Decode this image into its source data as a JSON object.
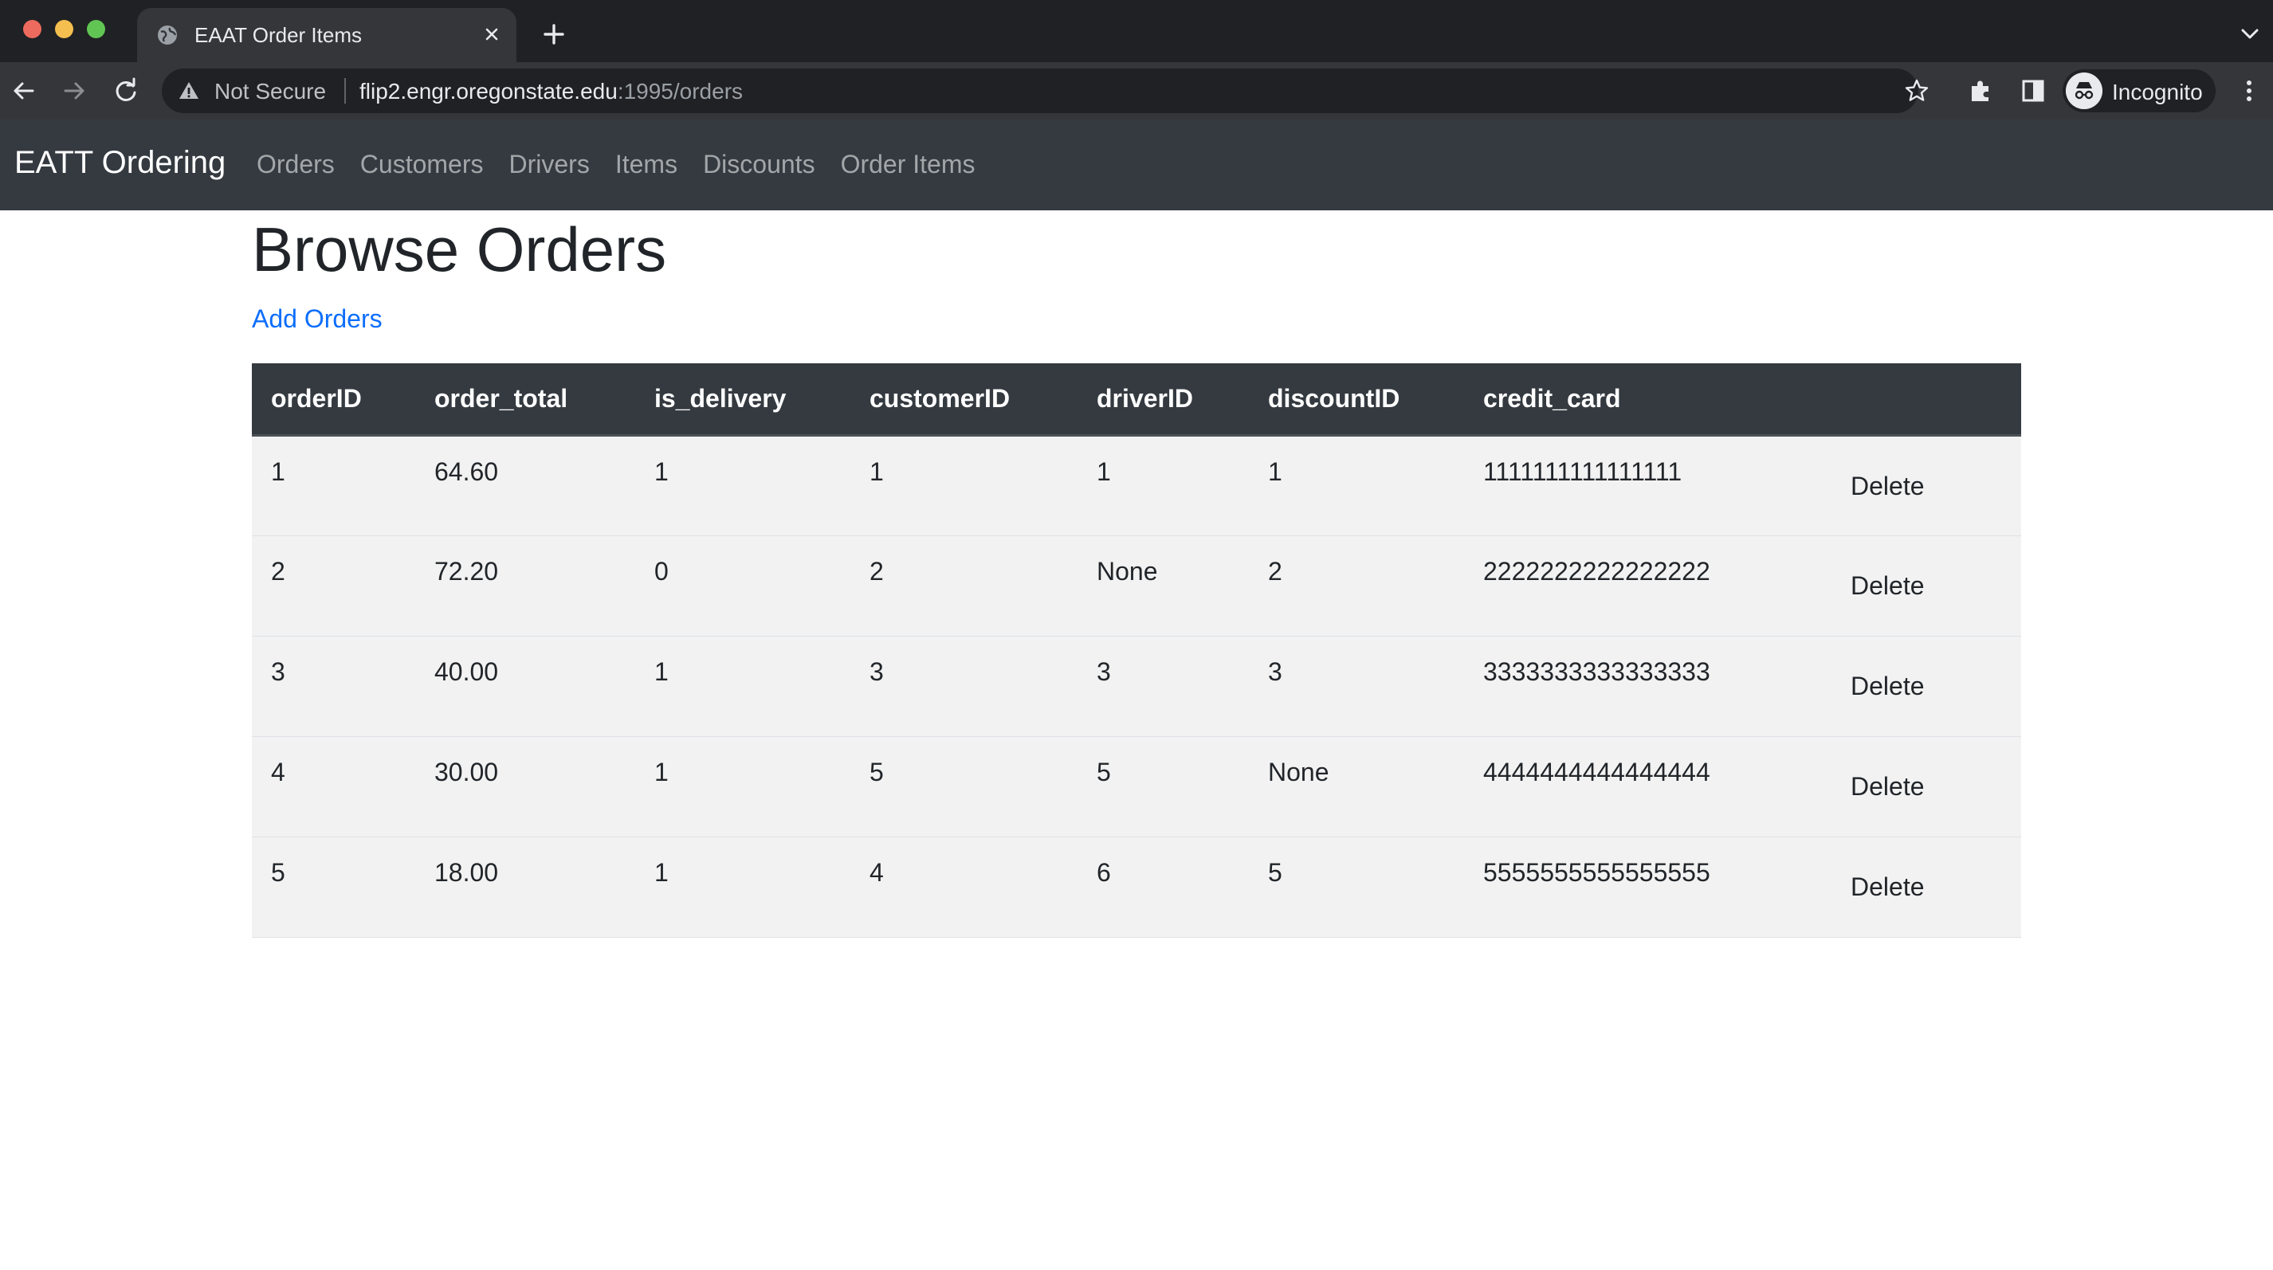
{
  "browser": {
    "tab_title": "EAAT Order Items",
    "security_label": "Not Secure",
    "url_host": "flip2.engr.oregonstate.edu",
    "url_path": ":1995/orders",
    "profile_label": "Incognito"
  },
  "navbar": {
    "brand": "EATT Ordering",
    "links": [
      "Orders",
      "Customers",
      "Drivers",
      "Items",
      "Discounts",
      "Order Items"
    ]
  },
  "main": {
    "title": "Browse Orders",
    "add_link": "Add Orders"
  },
  "table": {
    "headers": [
      "orderID",
      "order_total",
      "is_delivery",
      "customerID",
      "driverID",
      "discountID",
      "credit_card",
      ""
    ],
    "rows": [
      {
        "cells": [
          "1",
          "64.60",
          "1",
          "1",
          "1",
          "1",
          "1111111111111111"
        ],
        "action": "Delete"
      },
      {
        "cells": [
          "2",
          "72.20",
          "0",
          "2",
          "None",
          "2",
          "2222222222222222"
        ],
        "action": "Delete"
      },
      {
        "cells": [
          "3",
          "40.00",
          "1",
          "3",
          "3",
          "3",
          "3333333333333333"
        ],
        "action": "Delete"
      },
      {
        "cells": [
          "4",
          "30.00",
          "1",
          "5",
          "5",
          "None",
          "4444444444444444"
        ],
        "action": "Delete"
      },
      {
        "cells": [
          "5",
          "18.00",
          "1",
          "4",
          "6",
          "5",
          "5555555555555555"
        ],
        "action": "Delete"
      }
    ]
  },
  "colors": {
    "navbar_bg": "#343a40",
    "link_blue": "#0d6efd",
    "row_bg": "#f2f2f2"
  }
}
